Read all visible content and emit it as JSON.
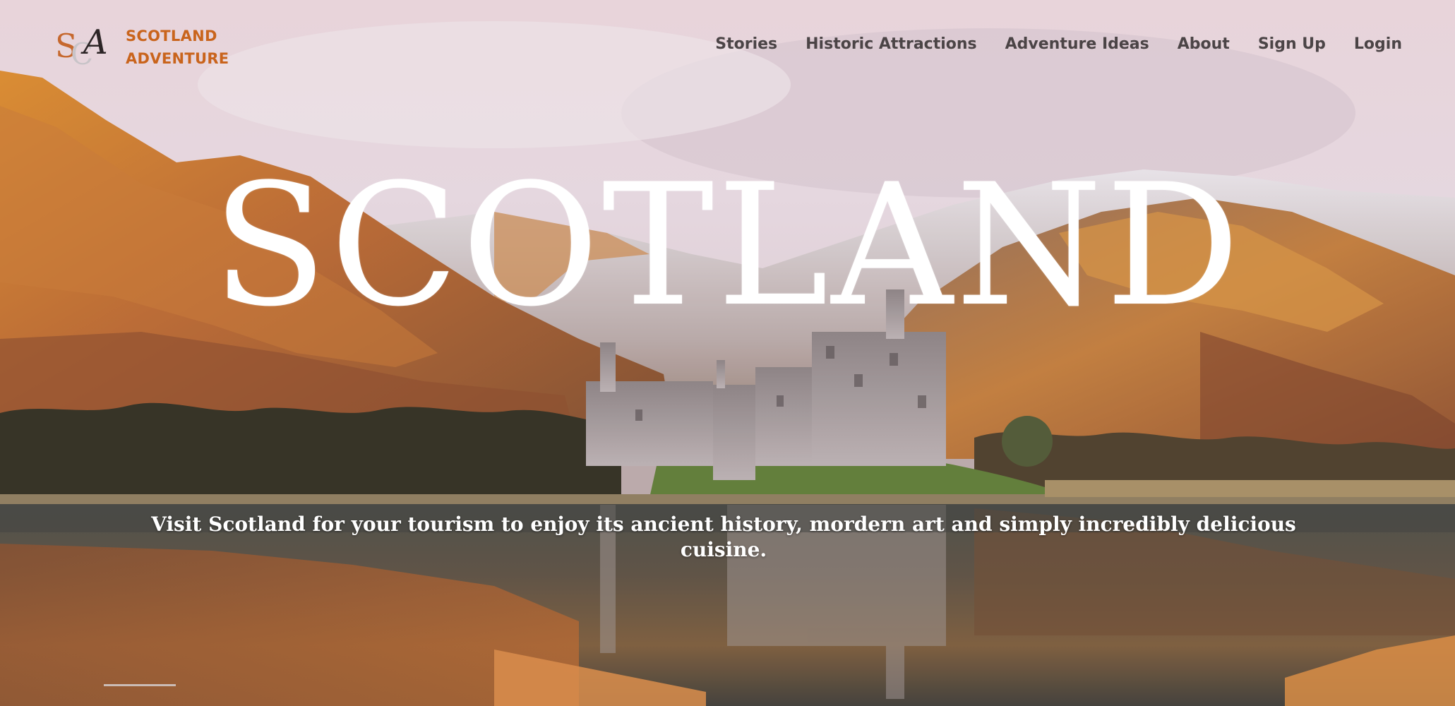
{
  "brand": {
    "mark_letters": [
      "S",
      "C",
      "A"
    ],
    "line1": "SCOTLAND",
    "line2": "ADVENTURE",
    "colors": {
      "primary": "#c9641c",
      "dark": "#2c2526",
      "light": "#c8c4c8"
    }
  },
  "nav": {
    "items": [
      {
        "label": "Stories"
      },
      {
        "label": "Historic Attractions"
      },
      {
        "label": "Adventure Ideas"
      },
      {
        "label": "About"
      },
      {
        "label": "Sign Up"
      },
      {
        "label": "Login"
      }
    ],
    "color": "#4b4446"
  },
  "hero": {
    "title": "SCOTLAND",
    "tagline": "Visit Scotland for your tourism to enjoy its ancient history, mordern art and simply incredibly delicious cuisine."
  }
}
